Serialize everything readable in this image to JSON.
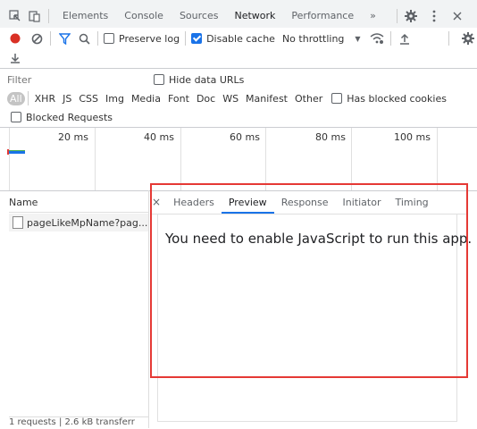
{
  "tabs": [
    {
      "label": "Elements"
    },
    {
      "label": "Console"
    },
    {
      "label": "Sources"
    },
    {
      "label": "Network",
      "active": true
    },
    {
      "label": "Performance"
    }
  ],
  "more_tabs_label": "»",
  "toolbar": {
    "preserve_log": "Preserve log",
    "disable_cache": "Disable cache",
    "throttling": "No throttling"
  },
  "filter": {
    "placeholder": "Filter",
    "hide_data_urls": "Hide data URLs",
    "types": [
      "All",
      "XHR",
      "JS",
      "CSS",
      "Img",
      "Media",
      "Font",
      "Doc",
      "WS",
      "Manifest",
      "Other"
    ],
    "has_blocked_cookies": "Has blocked cookies",
    "blocked_requests": "Blocked Requests"
  },
  "timeline": {
    "ticks": [
      "20 ms",
      "40 ms",
      "60 ms",
      "80 ms",
      "100 ms"
    ]
  },
  "requests": {
    "name_header": "Name",
    "items": [
      "pageLikeMpName?pag..."
    ],
    "status": "1 requests | 2.6 kB transferr"
  },
  "details": {
    "close": "×",
    "tabs": [
      "Headers",
      "Preview",
      "Response",
      "Initiator",
      "Timing"
    ],
    "active_tab": "Preview",
    "preview_text": "You need to enable JavaScript to run this app."
  },
  "colors": {
    "accent": "#1a73e8",
    "record": "#d93025",
    "highlight": "#e53935"
  }
}
